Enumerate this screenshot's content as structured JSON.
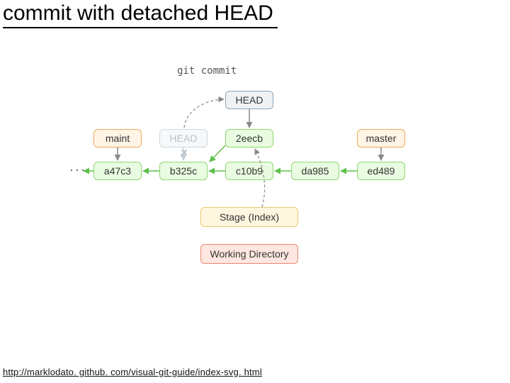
{
  "title": "commit with detached HEAD",
  "command": "git commit",
  "head_new": "HEAD",
  "head_old": "HEAD",
  "branches": {
    "maint": "maint",
    "master": "master"
  },
  "commits": {
    "a47c3": "a47c3",
    "b325c": "b325c",
    "c10b9": "c10b9",
    "da985": "da985",
    "ed489": "ed489",
    "new": "2eecb"
  },
  "stage": "Stage (Index)",
  "wd": "Working Directory",
  "footer": "http://marklodato. github. com/visual-git-guide/index-svg. html"
}
